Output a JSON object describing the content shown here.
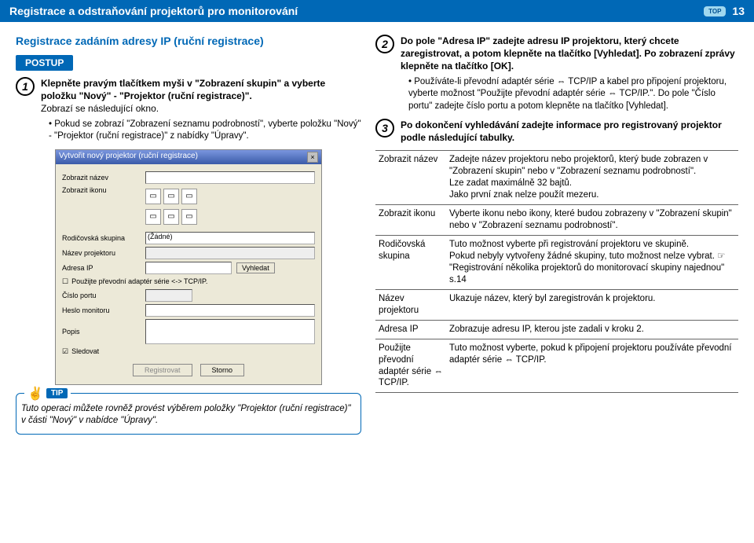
{
  "header": {
    "title": "Registrace a odstraňování projektorů pro monitorování",
    "badge": "TOP",
    "page": "13"
  },
  "left": {
    "section_title": "Registrace zadáním adresy IP (ruční registrace)",
    "postup": "POSTUP",
    "step1": {
      "num": "1",
      "bold": "Klepněte pravým tlačítkem myši v \"Zobrazení skupin\" a vyberte položku \"Nový\" - \"Projektor (ruční registrace)\".",
      "line2": "Zobrazí se následující okno.",
      "bullet": "Pokud se zobrazí \"Zobrazení seznamu podrobností\", vyberte položku \"Nový\" - \"Projektor (ruční registrace)\" z nabídky \"Úpravy\"."
    },
    "screenshot": {
      "title": "Vytvořit nový projektor (ruční registrace)",
      "lbl_name": "Zobrazit název",
      "lbl_icon": "Zobrazit ikonu",
      "lbl_parent": "Rodičovská skupina",
      "parent_val": "(Žádné)",
      "lbl_projname": "Název projektoru",
      "lbl_ip": "Adresa IP",
      "btn_search": "Vyhledat",
      "chk_adapter": "Použijte převodní adaptér série <-> TCP/IP.",
      "lbl_port": "Číslo portu",
      "lbl_pass": "Heslo monitoru",
      "lbl_desc": "Popis",
      "chk_monitor": "Sledovat",
      "btn_register": "Registrovat",
      "btn_cancel": "Storno"
    },
    "tip": {
      "label": "TIP",
      "body": "Tuto operaci můžete rovněž provést výběrem položky \"Projektor (ruční registrace)\" v části \"Nový\" v nabídce \"Úpravy\"."
    }
  },
  "right": {
    "step2": {
      "num": "2",
      "bold": "Do pole \"Adresa IP\" zadejte adresu IP projektoru, který chcete zaregistrovat, a potom klepněte na tlačítko [Vyhledat]. Po zobrazení zprávy klepněte na tlačítko [OK].",
      "bullet": "Používáte-li převodní adaptér série ⇔ TCP/IP a kabel pro připojení projektoru, vyberte možnost \"Použijte převodní adaptér série ⇔ TCP/IP.\". Do pole \"Číslo portu\" zadejte číslo portu a potom klepněte na tlačítko [Vyhledat]."
    },
    "step3": {
      "num": "3",
      "bold": "Po dokončení vyhledávání zadejte informace pro registrovaný projektor podle následující tabulky."
    },
    "table": {
      "r1k": "Zobrazit název",
      "r1v": "Zadejte název projektoru nebo projektorů, který bude zobrazen v \"Zobrazení skupin\" nebo v \"Zobrazení seznamu podrobností\".\nLze zadat maximálně 32 bajtů.\nJako první znak nelze použít mezeru.",
      "r2k": "Zobrazit ikonu",
      "r2v": "Vyberte ikonu nebo ikony, které budou zobrazeny v \"Zobrazení skupin\" nebo v \"Zobrazení seznamu podrobností\".",
      "r3k": "Rodičovská skupina",
      "r3v_a": "Tuto možnost vyberte při registrování projektoru ve skupině.\nPokud nebyly vytvořeny žádné skupiny, tuto možnost nelze vybrat. ",
      "r3v_link": "☞ \"Registrování několika projektorů do monitorovací skupiny najednou\" s.14",
      "r4k": "Název projektoru",
      "r4v": "Ukazuje název, který byl zaregistrován k projektoru.",
      "r5k": "Adresa IP",
      "r5v": "Zobrazuje adresu IP, kterou jste zadali v kroku 2.",
      "r6k": "Použijte převodní adaptér série ⇔ TCP/IP.",
      "r6v": "Tuto možnost vyberte, pokud k připojení projektoru používáte převodní adaptér série ⇔ TCP/IP."
    }
  }
}
